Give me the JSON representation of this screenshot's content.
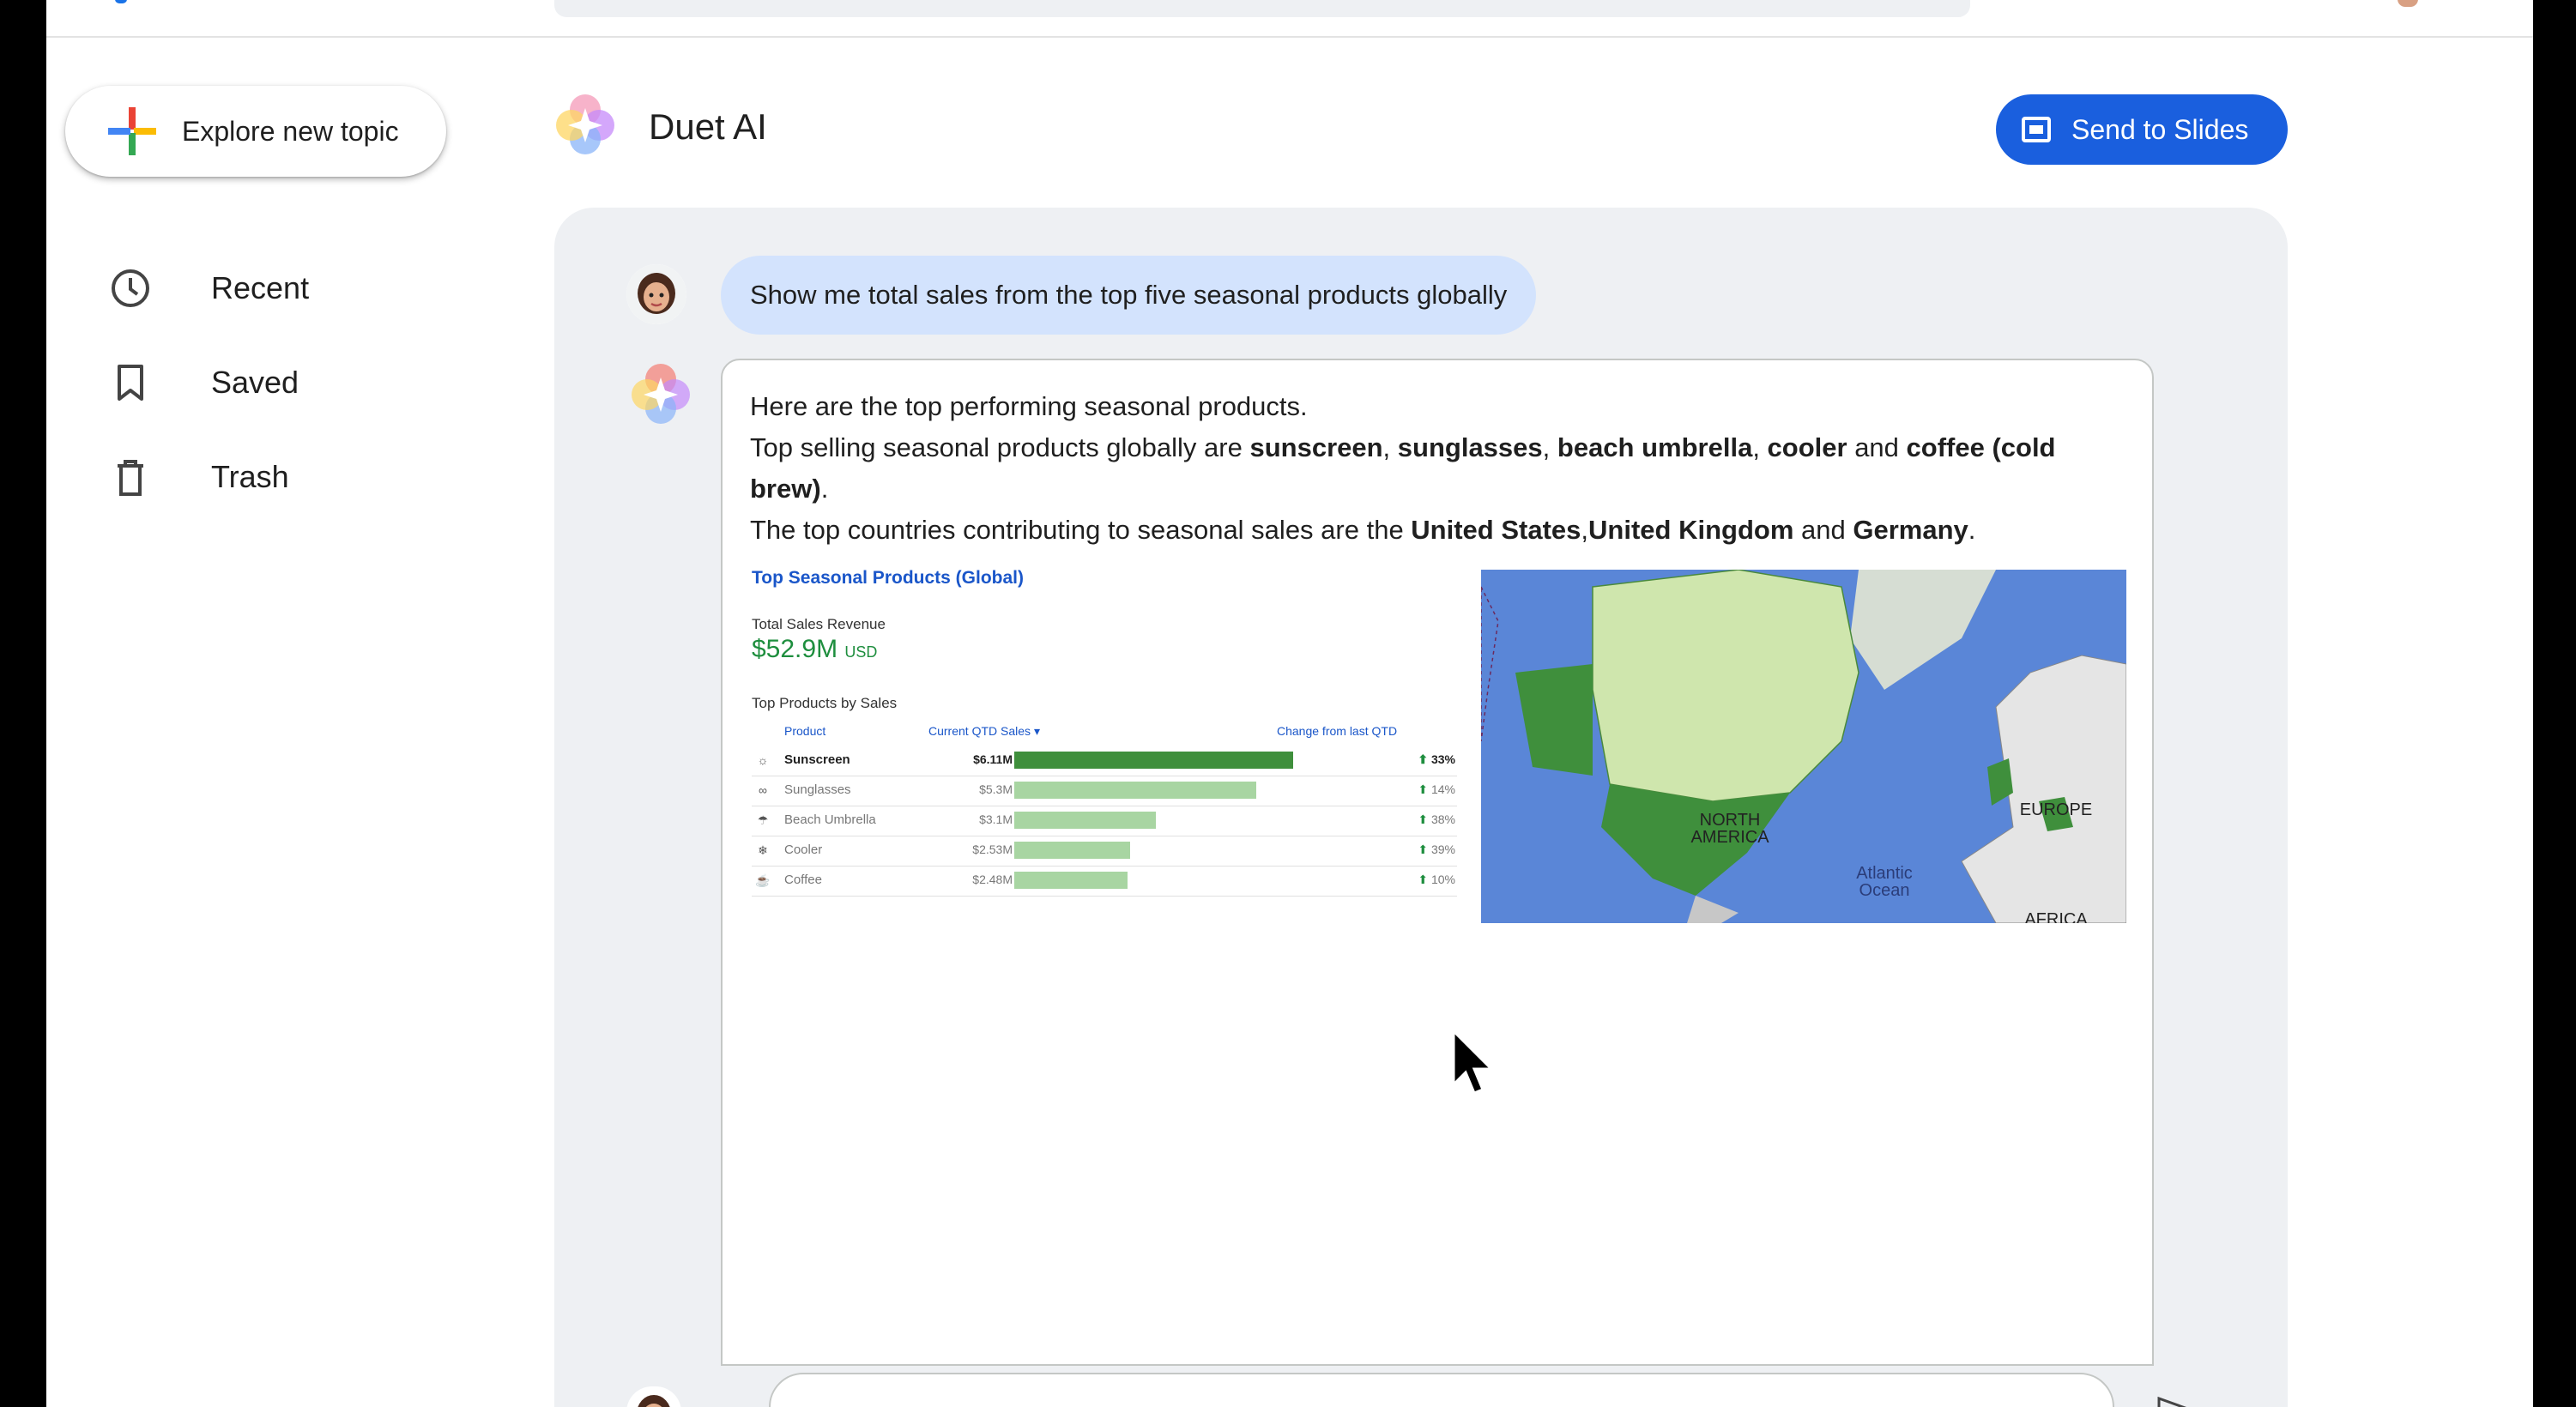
{
  "sidebar": {
    "explore_label": "Explore new topic",
    "items": [
      {
        "label": "Recent",
        "icon": "clock-icon"
      },
      {
        "label": "Saved",
        "icon": "bookmark-icon"
      },
      {
        "label": "Trash",
        "icon": "trash-icon"
      }
    ]
  },
  "header": {
    "title": "Duet AI",
    "send_to_slides_label": "Send to Slides"
  },
  "chat": {
    "user_prompt": "Show me total sales from the top five seasonal products globally",
    "response": {
      "line1": "Here are the top performing seasonal products.",
      "line2_prefix": "Top selling seasonal products globally are ",
      "p1": "sunscreen",
      "sep1": ", ",
      "p2": "sunglasses",
      "sep2": ", ",
      "p3": "beach umbrella",
      "sep3": ", ",
      "p4": "cooler",
      "sep4": " and ",
      "p5": "coffee (cold brew)",
      "line2_end": ".",
      "line3_prefix": "The top countries contributing to seasonal sales are the ",
      "c1": "United States",
      "sep5": ",",
      "c2": "United Kingdom",
      "sep6": " and ",
      "c3": "Germany",
      "line3_end": "."
    },
    "dashboard": {
      "title": "Top Seasonal Products (Global)",
      "revenue_label": "Total Sales Revenue",
      "revenue_value": "$52.9M",
      "revenue_unit": "USD",
      "products_label": "Top Products by Sales",
      "col_product": "Product",
      "col_sales": "Current QTD Sales",
      "col_change": "Change from last QTD",
      "rows": [
        {
          "icon": "sun-icon",
          "glyph": "☼",
          "name": "Sunscreen",
          "value": "$6.11M",
          "amount": 6.11,
          "change": "33%"
        },
        {
          "icon": "glasses-icon",
          "glyph": "∞",
          "name": "Sunglasses",
          "value": "$5.3M",
          "amount": 5.3,
          "change": "14%"
        },
        {
          "icon": "umbrella-icon",
          "glyph": "☂",
          "name": "Beach Umbrella",
          "value": "$3.1M",
          "amount": 3.1,
          "change": "38%"
        },
        {
          "icon": "snowflake-icon",
          "glyph": "❄",
          "name": "Cooler",
          "value": "$2.53M",
          "amount": 2.53,
          "change": "39%"
        },
        {
          "icon": "coffee-cup-icon",
          "glyph": "☕",
          "name": "Coffee",
          "value": "$2.48M",
          "amount": 2.48,
          "change": "10%"
        }
      ]
    },
    "map": {
      "label_north_america": "NORTH AMERICA",
      "label_atlantic": "Atlantic Ocean",
      "label_europe": "EUROPE",
      "label_africa": "AFRICA"
    }
  },
  "colors": {
    "accent": "#1a5fde",
    "bubble": "#d3e3fd",
    "panel": "#eef0f3",
    "positive": "#1e8e3e"
  }
}
